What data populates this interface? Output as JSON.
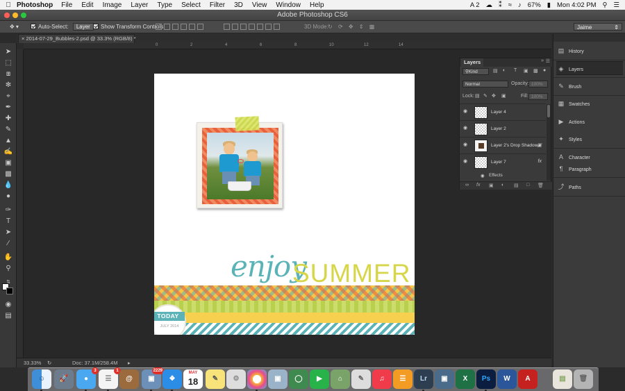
{
  "menubar": {
    "app_name": "Photoshop",
    "items": [
      "File",
      "Edit",
      "Image",
      "Layer",
      "Type",
      "Select",
      "Filter",
      "3D",
      "View",
      "Window",
      "Help"
    ],
    "status": {
      "adobe_count": "2",
      "battery": "67%",
      "clock": "Mon 4:02 PM"
    }
  },
  "window": {
    "title": "Adobe Photoshop CS6"
  },
  "options_bar": {
    "auto_select_label": "Auto-Select:",
    "auto_select_value": "Layer",
    "show_transform_label": "Show Transform Controls",
    "mode_3d_label": "3D Mode:",
    "workspace": "Jaime"
  },
  "document": {
    "tab_label": "2014-07-29_Bubbles-2.psd @ 33.3% (RGB/8) *",
    "zoom": "33.33%",
    "doc_size": "Doc: 37.1M/258.4M"
  },
  "ruler": {
    "h_ticks": [
      "0",
      "2",
      "4",
      "6",
      "8",
      "10",
      "12",
      "14"
    ]
  },
  "artwork": {
    "enjoy": "enjoy",
    "summer": "SUMMER",
    "today": "TODAY",
    "date": "JULY 2014"
  },
  "layers_panel": {
    "title": "Layers",
    "kind_filter": "Kind",
    "blend_mode": "Normal",
    "opacity_label": "Opacity:",
    "opacity_value": "100%",
    "lock_label": "Lock:",
    "fill_label": "Fill:",
    "fill_value": "100%",
    "layers": [
      {
        "name": "Layer 4",
        "fx": false
      },
      {
        "name": "Layer 2",
        "fx": false
      },
      {
        "name": "Layer 2's Drop Shadow",
        "fx": false
      },
      {
        "name": "Layer 7",
        "fx": true
      }
    ],
    "effects_label": "Effects"
  },
  "right_dock": {
    "items": [
      "History",
      "Layers",
      "Brush",
      "Swatches",
      "Actions",
      "Styles",
      "Character",
      "Paragraph",
      "Paths"
    ]
  },
  "dock": {
    "mail_badge": "3",
    "reminders_badge": "1",
    "preview_badge": "2229",
    "calendar_month": "MAY",
    "calendar_day": "18"
  },
  "colors": {
    "enjoy_text": "#5bb3b7",
    "summer_text": "#d6d648",
    "panel_bg": "#3a3a3a"
  }
}
